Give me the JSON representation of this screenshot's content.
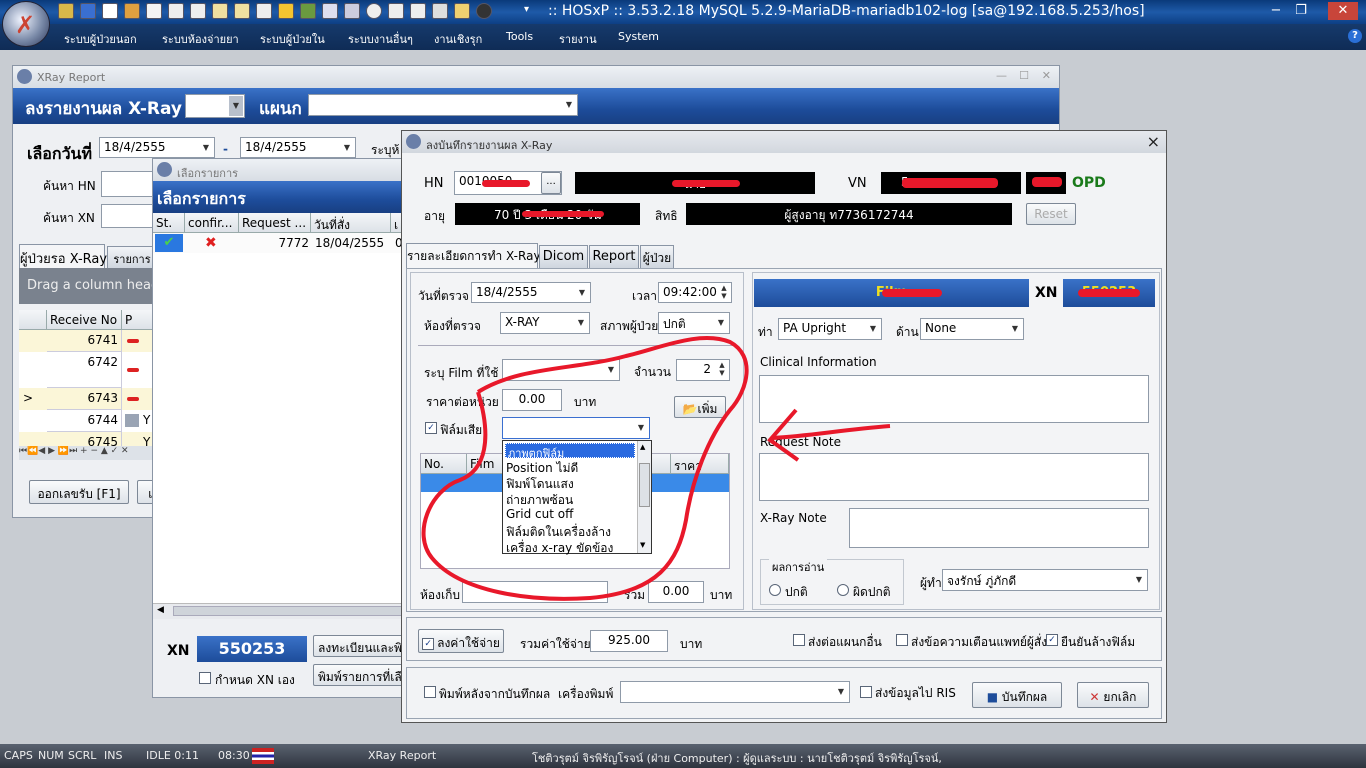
{
  "app": {
    "title": ":: HOSxP :: 3.53.2.18 MySQL 5.2.9-MariaDB-mariadb102-log [sa@192.168.5.253/hos]"
  },
  "menu": [
    "ระบบผู้ป่วยนอก",
    "ระบบห้องจ่ายยา",
    "ระบบผู้ป่วยใน",
    "ระบบงานอื่นๆ",
    "งานเชิงรุก",
    "Tools",
    "รายงาน",
    "System"
  ],
  "xray_report": {
    "title": "XRay Report",
    "header": "ลงรายงานผล X-Ray",
    "dept_label": "แผนก",
    "date_label": "เลือกวันที่",
    "date_from": "18/4/2555",
    "date_sep": "-",
    "date_to": "18/4/2555",
    "hn_label": "ค้นหา HN",
    "xn_label": "ค้นหา XN",
    "right_trunc": "ระบุห้",
    "tabs": [
      "ผู้ป่วยรอ X-Ray",
      "รายการ"
    ],
    "group_hint": "Drag a column heade",
    "cols": [
      "Receive No",
      "P"
    ],
    "rows": [
      "6741",
      "6742",
      "6743",
      "6744",
      "6745"
    ],
    "row_marker": ">",
    "row_tail": "Y",
    "nav": "⏮⏪◀ ▶ ⏩⏭ + − ▲ ✓ ✕",
    "btn_issue": "ออกเลขรับ [F1]",
    "btn_trunc": "แ"
  },
  "select_list": {
    "title": "เลือกรายการ",
    "header": "เลือกรายการ",
    "cols": [
      "St.",
      "confir...",
      "Request ...",
      "วันที่สั่ง",
      "เ"
    ],
    "row": {
      "request": "7772",
      "date": "18/04/2555",
      "last": "0"
    },
    "xn_label": "XN",
    "xn_value": "550253",
    "chk_label": "กำหนด XN เอง",
    "btn_register": "ลงทะเบียนและพิม",
    "btn_print": "พิมพ์รายการที่เลือ"
  },
  "record": {
    "title": "ลงบันทึกรายงานผล X-Ray",
    "close": "×",
    "hn_label": "HN",
    "hn_value": "0010050",
    "hn_btn": "...",
    "name_value": "นาย",
    "vn_label": "VN",
    "vn_value": "5",
    "opd_label": "OPD",
    "age_label": "อายุ",
    "age_value": "70 ปี 3 เดือน 20 วัน",
    "right_label": "สิทธิ",
    "right_value": "ผู้สูงอายุ ท7736172744",
    "reset": "Reset",
    "tabs": [
      "รายละเอียดการทำ X-Ray",
      "Dicom",
      "Report",
      "ผู้ป่วย"
    ],
    "date_label": "วันที่ตรวจ",
    "date_value": "18/4/2555",
    "time_label": "เวลา",
    "time_value": "09:42:00",
    "room_label": "ห้องที่ตรวจ",
    "room_value": "X-RAY",
    "cond_label": "สภาพผู้ป่วย",
    "cond_value": "ปกติ",
    "film_label": "ระบุ Film ที่ใช้",
    "qty_label": "จำนวน",
    "qty_value": "2",
    "price_label": "ราคาต่อหน่วย",
    "price_value": "0.00",
    "baht": "บาท",
    "add_btn": "เพิ่ม",
    "waste_label": "ฟิล์มเสีย",
    "dropdown_options": [
      "ภาพตกฟิล์ม",
      "Position ไม่ดี",
      "ฟิมพ์โดนแสง",
      "ถ่ายภาพซ้อน",
      "Grid cut off",
      "ฟิล์มติดในเครื่องล้าง",
      "เครื่อง x-ray ขัดข้อง"
    ],
    "grid_cols": [
      "No.",
      "Film",
      "",
      "ราคา"
    ],
    "store_label": "ห้องเก็บ",
    "sum_label": "รวม",
    "sum_value": "0.00",
    "film_banner": "Film",
    "xn_label": "XN",
    "xn_value": "550253",
    "pos_label": "ท่า",
    "pos_value": "PA Upright",
    "side_label": "ด้าน",
    "side_value": "None",
    "clinical_label": "Clinical Information",
    "request_note_label": "Request Note",
    "xray_note_label": "X-Ray  Note",
    "result_group": "ผลการอ่าน",
    "result_normal": "ปกติ",
    "result_abnormal": "ผิดปกติ",
    "doctor_label": "ผู้ทำ",
    "doctor_value": "จงรักษ์ ภู่ภักดี",
    "cost_btn": "ลงค่าใช้จ่าย",
    "total_label": "รวมค่าใช้จ่าย",
    "total_value": "925.00",
    "total_baht": "บาท",
    "chk_send": "ส่งต่อแผนกอื่น",
    "chk_warn": "ส่งข้อความเตือนแพทย์ผู้สั่ง",
    "chk_confirm": "ยืนยันล้างฟิล์ม",
    "chk_print": "พิมพ์หลังจากบันทึกผล",
    "printer_label": "เครื่องพิมพ์",
    "chk_ris": "ส่งข้อมูลไป RIS",
    "save_btn": "บันทึกผล",
    "cancel_btn": "ยกเลิก"
  },
  "status": {
    "caps": "CAPS",
    "num": "NUM",
    "scrl": "SCRL",
    "ins": "INS",
    "idle": "IDLE 0:11",
    "time": "08:30",
    "module": "XRay Report",
    "user": "โชติวรุตม์  จิรพิรัญโรจน์ (ฝ่าย Computer) : ผู้ดูแลระบบ : นายโชติวรุตม์  จิรพิรัญโรจน์,"
  },
  "colors": {
    "header_blue": "#1d4c9a",
    "annotation_red": "#e8182a",
    "opd_green": "#1a7a1a"
  }
}
